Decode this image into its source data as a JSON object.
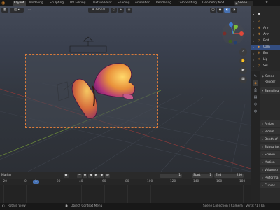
{
  "topbar": {
    "tabs": [
      "Layout",
      "Modeling",
      "Sculpting",
      "UV Editing",
      "Texture Paint",
      "Shading",
      "Animation",
      "Rendering",
      "Compositing",
      "Geometry Nod"
    ],
    "active_tab": "Layout",
    "scene": "Scene",
    "icons": [
      "blender-logo-icon",
      "scene-icon",
      "close-icon"
    ]
  },
  "viewport": {
    "mode_select": "Global",
    "header_icons": [
      "editor-type-icon",
      "object-mode-icon",
      "view-menu-icon",
      "transform-orientation-icon",
      "pivot-icon",
      "snap-icon",
      "proportional-edit-icon",
      "shading-wireframe-icon",
      "shading-solid-icon",
      "shading-material-icon",
      "shading-rendered-icon"
    ],
    "gizmo": {
      "x_color": "#e0483a",
      "y_color": "#7cbf3a",
      "z_color": "#3d7bd6"
    },
    "tools": [
      "zoom-icon",
      "pan-icon",
      "camera-view-icon",
      "perspective-icon"
    ],
    "frame_color": "#d87a3a"
  },
  "outliner": {
    "rows": [
      {
        "label": "",
        "icon": "collection-icon",
        "selected": false
      },
      {
        "label": "",
        "icon": "object-icon",
        "selected": false
      },
      {
        "label": "Arm",
        "icon": "armature-icon",
        "selected": false
      },
      {
        "label": "Arm",
        "icon": "armature-icon",
        "selected": false
      },
      {
        "label": "Bod",
        "icon": "mesh-icon",
        "selected": false
      },
      {
        "label": "Cam",
        "icon": "camera-icon",
        "selected": true
      },
      {
        "label": "Em",
        "icon": "empty-icon",
        "selected": false
      },
      {
        "label": "Lig",
        "icon": "light-icon",
        "selected": false
      },
      {
        "label": "Sel",
        "icon": "object-icon",
        "selected": false
      }
    ]
  },
  "properties": {
    "scene_label": "Scene",
    "render_label": "Render",
    "panels": [
      "Sampling",
      "Ambie",
      "Bloom",
      "Depth of",
      "Subsurfac",
      "Screen",
      "Motion",
      "Volumetr",
      "Performa",
      "Curves"
    ]
  },
  "timeline": {
    "label": "Marker",
    "current_frame": "1",
    "start_label": "Start",
    "start_value": "1",
    "end_label": "End",
    "end_value": "250",
    "ruler": [
      "-20",
      "0",
      "20",
      "40",
      "60",
      "80",
      "100",
      "120",
      "140",
      "160",
      "180"
    ],
    "playhead": "1",
    "playback_icons": [
      "record-icon",
      "jump-start-icon",
      "prev-key-icon",
      "play-reverse-icon",
      "play-icon",
      "next-key-icon",
      "jump-end-icon"
    ]
  },
  "statusbar": {
    "left": "Rotate View",
    "middle": "Object Context Menu",
    "right": "Scene Collection | Camera | Verts:71 | Fa"
  }
}
